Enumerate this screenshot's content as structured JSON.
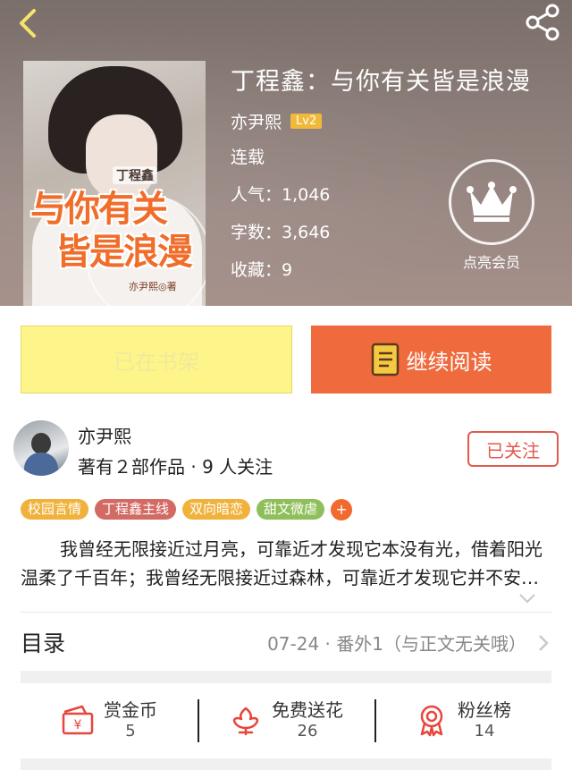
{
  "header": {
    "back_icon": "back-chevron-icon",
    "share_icon": "share-icon"
  },
  "cover": {
    "sub_title": "丁程鑫",
    "title_line1": "与你有关",
    "title_line2": "皆是浪漫",
    "author": "亦尹熙◎著"
  },
  "book": {
    "title": "丁程鑫：与你有关皆是浪漫",
    "author": "亦尹熙",
    "level": "Lv2",
    "status": "连载",
    "popularity": "人气：1,046",
    "word_count": "字数：3,646",
    "favorites": "收藏：9"
  },
  "vip": {
    "label": "点亮会员",
    "icon": "crown-icon"
  },
  "actions": {
    "shelf_label": "已在书架",
    "read_label": "继续阅读",
    "read_icon": "book-icon"
  },
  "author_card": {
    "name": "亦尹熙",
    "stats": "著有２部作品 · 9 人关注",
    "follow_label": "已关注"
  },
  "tags": [
    {
      "label": "校园言情",
      "color": "#f0b23c"
    },
    {
      "label": "丁程鑫主线",
      "color": "#d36a64"
    },
    {
      "label": "双向暗恋",
      "color": "#f0b23c"
    },
    {
      "label": "甜文微虐",
      "color": "#8fbf5a"
    }
  ],
  "tag_more": "+",
  "description": "我曾经无限接近过月亮，可靠近才发现它本没有光，借着阳光温柔了千百年；我曾经无限接近过森林，可靠近才发现它并不安静，风吹过枝叶沙沙作响。",
  "catalog": {
    "title": "目录",
    "latest": "07-24 · 番外1（与正文无关哦）"
  },
  "stats": [
    {
      "label": "赏金币",
      "value": "5",
      "icon": "coin-envelope-icon"
    },
    {
      "label": "免费送花",
      "value": "26",
      "icon": "flower-icon"
    },
    {
      "label": "粉丝榜",
      "value": "14",
      "icon": "medal-icon"
    }
  ],
  "colors": {
    "accent_orange": "#ef6a3c",
    "shelf_yellow": "#fdf58a",
    "follow_red": "#e15a4e",
    "icon_red": "#e8453c"
  }
}
